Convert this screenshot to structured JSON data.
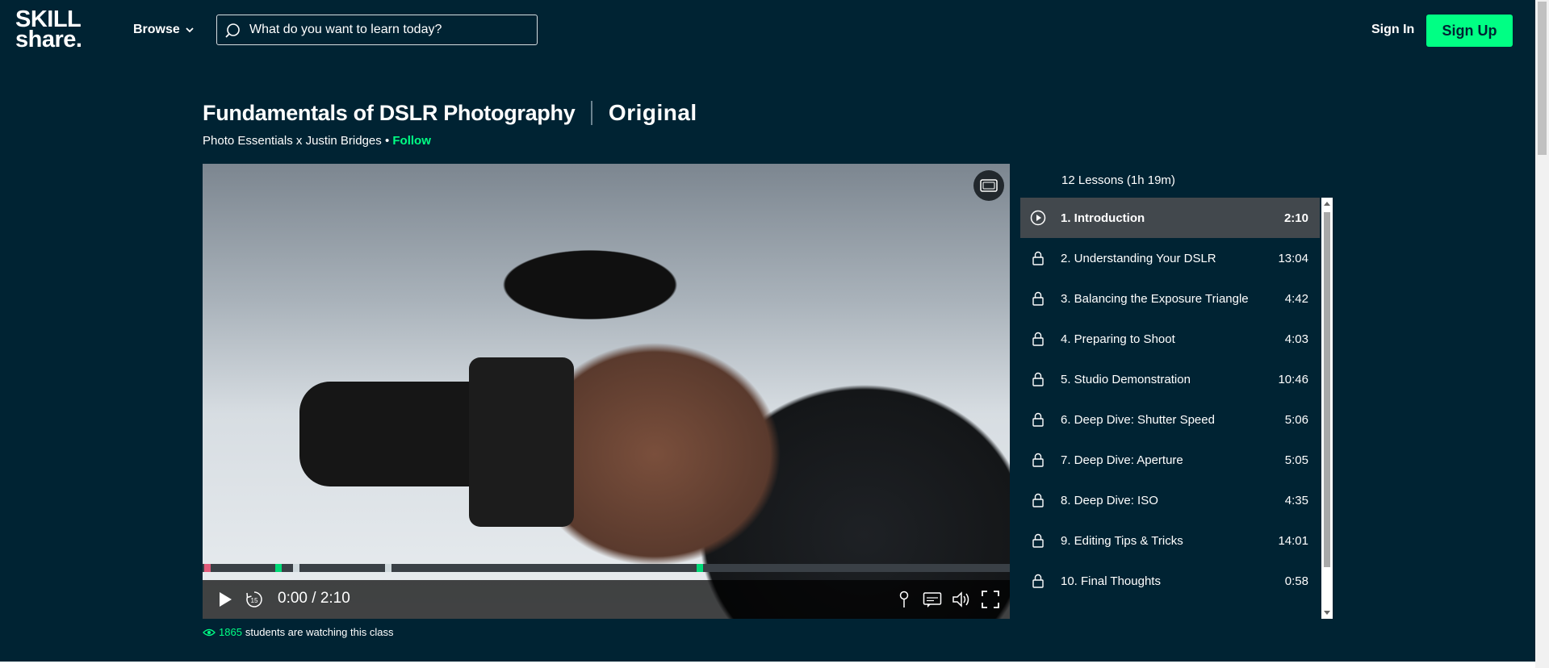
{
  "header": {
    "logo_line1": "SKILL",
    "logo_line2": "share.",
    "browse_label": "Browse",
    "search_placeholder": "What do you want to learn today?",
    "signin_label": "Sign In",
    "signup_label": "Sign Up"
  },
  "course": {
    "title": "Fundamentals of DSLR Photography",
    "badge": "Original",
    "byline": "Photo Essentials x Justin Bridges •",
    "follow_label": "Follow"
  },
  "player": {
    "time": "0:00 / 2:10",
    "skip_label": "15",
    "progress_fraction": 0
  },
  "viewers": {
    "count": "1865",
    "suffix": "students are watching this class"
  },
  "lessons": {
    "summary": "12 Lessons (1h 19m)",
    "items": [
      {
        "title": "1. Introduction",
        "duration": "2:10"
      },
      {
        "title": "2. Understanding Your DSLR",
        "duration": "13:04"
      },
      {
        "title": "3. Balancing the Exposure Triangle",
        "duration": "4:42"
      },
      {
        "title": "4. Preparing to Shoot",
        "duration": "4:03"
      },
      {
        "title": "5. Studio Demonstration",
        "duration": "10:46"
      },
      {
        "title": "6. Deep Dive: Shutter Speed",
        "duration": "5:06"
      },
      {
        "title": "7. Deep Dive: Aperture",
        "duration": "5:05"
      },
      {
        "title": "8. Deep Dive: ISO",
        "duration": "4:35"
      },
      {
        "title": "9. Editing Tips & Tricks",
        "duration": "14:01"
      },
      {
        "title": "10. Final Thoughts",
        "duration": "0:58"
      }
    ]
  },
  "colors": {
    "background": "#002333",
    "accent": "#00ff84",
    "active_row": "#42484d"
  }
}
